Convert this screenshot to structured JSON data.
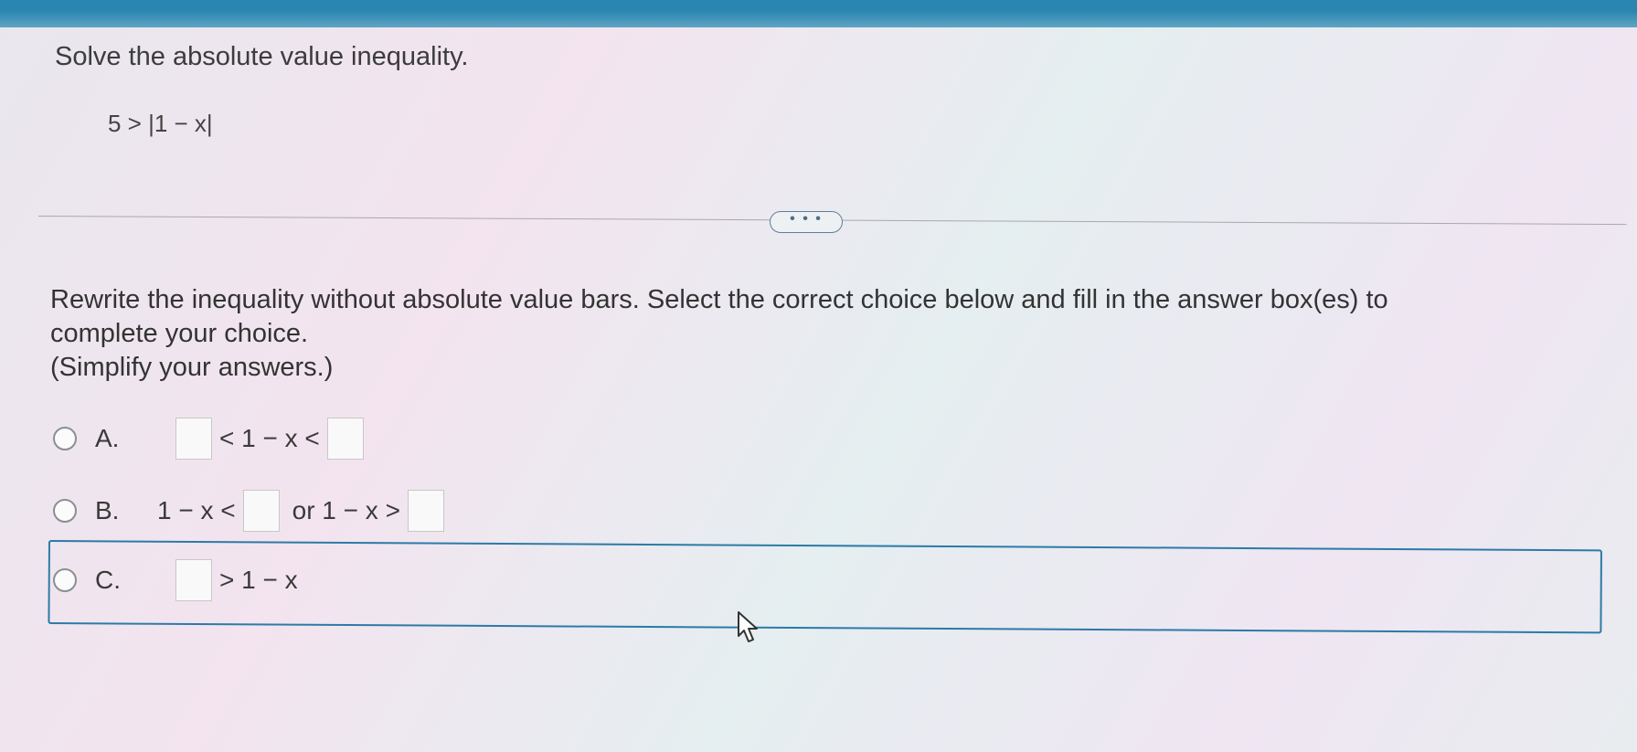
{
  "header": {
    "accent_color": "#2a86b0"
  },
  "question": {
    "title": "Solve the absolute value inequality.",
    "inequality": "5 > |1 − x|"
  },
  "expand_button": {
    "label": "• • •"
  },
  "instruction": {
    "line1": "Rewrite the inequality without absolute value bars. Select the correct choice below and fill in the answer box(es) to",
    "line2": "complete your choice.",
    "line3": "(Simplify your answers.)"
  },
  "choices": {
    "a": {
      "letter": "A.",
      "middle": "< 1 − x <",
      "box1_value": "",
      "box2_value": ""
    },
    "b": {
      "letter": "B.",
      "part1": "1 − x <",
      "connector": "or 1 − x >",
      "box1_value": "",
      "box2_value": ""
    },
    "c": {
      "letter": "C.",
      "tail": "> 1 − x",
      "box1_value": "",
      "highlight_color": "#2d7aa7"
    }
  },
  "icons": {
    "cursor": "mouse-pointer-icon"
  }
}
